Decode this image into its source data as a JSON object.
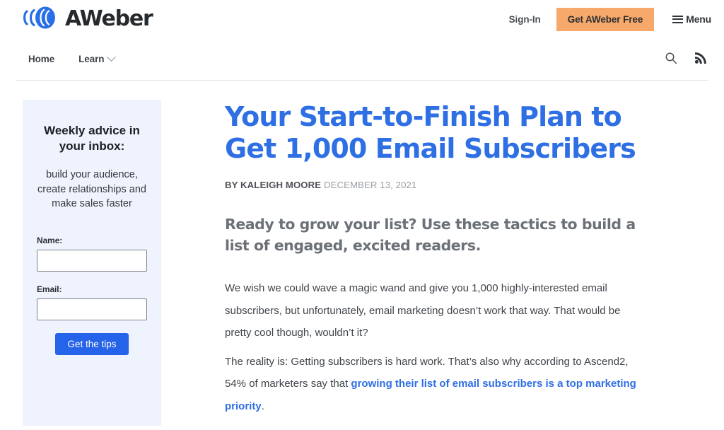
{
  "header": {
    "logo_text": "AWeber",
    "logo_icon": "aweber-signal-logo",
    "signin_label": "Sign-In",
    "cta_label": "Get AWeber Free",
    "menu_label": "Menu",
    "menu_icon": "hamburger-icon"
  },
  "nav": {
    "items": [
      {
        "label": "Home",
        "has_chevron": false
      },
      {
        "label": "Learn",
        "has_chevron": true
      }
    ],
    "search_icon": "search-icon",
    "rss_icon": "rss-icon"
  },
  "sidebar": {
    "title": "Weekly advice in your inbox:",
    "description": "build your audience, create relationships and make sales faster",
    "name_label": "Name:",
    "name_value": "",
    "email_label": "Email:",
    "email_value": "",
    "submit_label": "Get the tips"
  },
  "article": {
    "title": "Your Start-to-Finish Plan to Get 1,000 Email Subscribers",
    "byline_author": "BY KALEIGH MOORE",
    "byline_date": "DECEMBER 13, 2021",
    "subheading": "Ready to grow your list? Use these tactics to build a list of engaged, excited readers.",
    "paragraph_1": "We wish we could wave a magic wand and give you 1,000 highly-interested email subscribers, but unfortunately, email marketing doesn’t work that way. That would be pretty cool though, wouldn’t it?",
    "paragraph_2_before": "The reality is: Getting subscribers is hard work. That’s also why according to Ascend2, 54% of marketers say that ",
    "paragraph_2_link": "growing their list of email subscribers is a top marketing priority",
    "paragraph_2_after": "."
  },
  "colors": {
    "brand_blue": "#2970e8",
    "title_blue": "#2f6fe4",
    "cta_orange": "#f6a96a",
    "sidebar_bg": "#eef3fd",
    "submit_blue": "#2563e8"
  }
}
